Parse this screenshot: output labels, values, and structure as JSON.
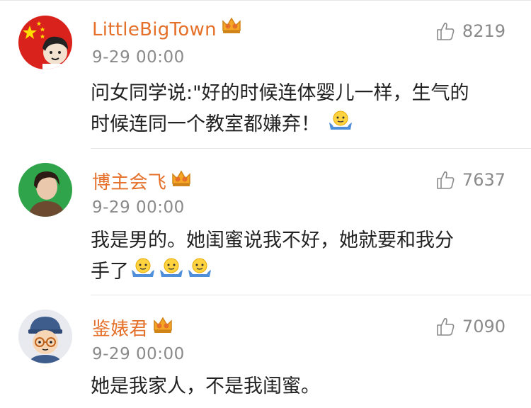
{
  "comments": [
    {
      "username": "LittleBigTown",
      "timestamp": "9-29 00:00",
      "likes": "8219",
      "text_lines": [
        "问女同学说:\"好的时候连体婴儿一样，生气的",
        "时候连同一个教室都嫌弃！"
      ],
      "avatar_icon": "china-flag-avatar-icon",
      "badge_icon": "vip-crown-badge-icon",
      "emoji_icon": "shrug-emoji-icon"
    },
    {
      "username": "博主会飞",
      "timestamp": "9-29 00:00",
      "likes": "7637",
      "text_lines": [
        "我是男的。她闺蜜说我不好，她就要和我分",
        "手了"
      ],
      "avatar_icon": "person-photo-avatar-icon",
      "badge_icon": "vip-crown-badge-icon",
      "emoji_icon": "shrug-emoji-icon"
    },
    {
      "username": "鉴婊君",
      "timestamp": "9-29 00:00",
      "likes": "7090",
      "text_lines": [
        "她是我家人，不是我闺蜜。"
      ],
      "avatar_icon": "cartoon-boy-avatar-icon",
      "badge_icon": "vip-crown-badge-icon"
    }
  ],
  "colors": {
    "username": "#e4702a",
    "meta": "#8a8a8a",
    "text": "#222222",
    "divider": "#e5e5e5"
  }
}
